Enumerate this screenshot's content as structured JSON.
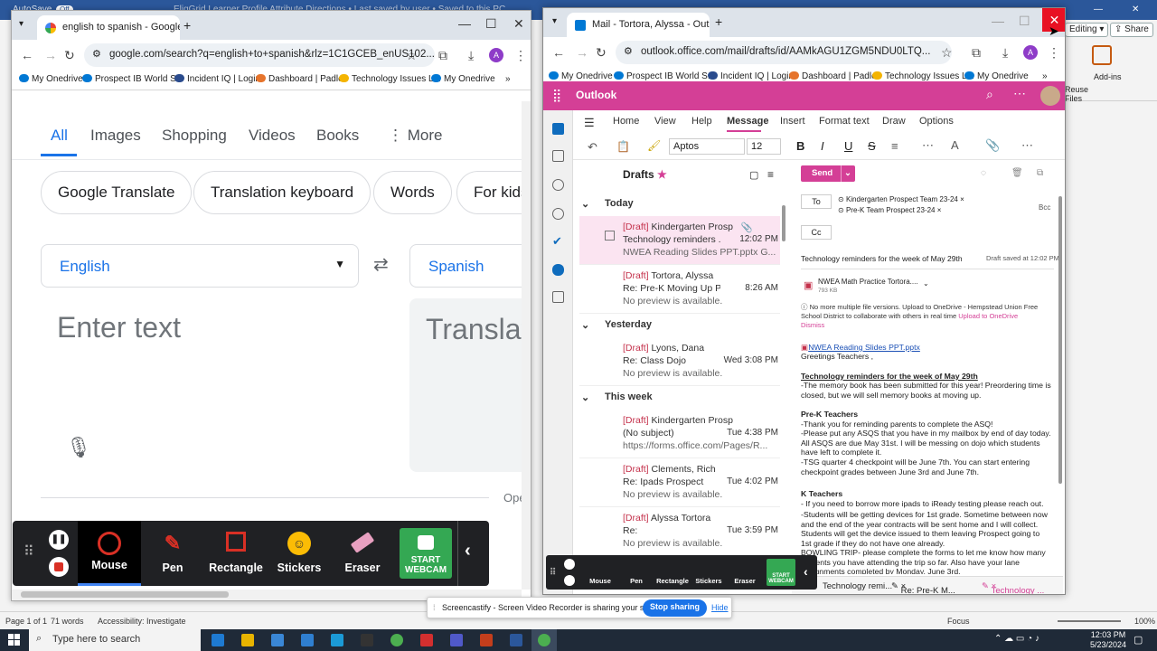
{
  "word": {
    "autosave": "AutoSave",
    "autosave_state": "Off",
    "title": "EligGrid Learner Profile Attribute Directions • Last saved by user • Saved to this PC",
    "search": "Search",
    "editing": "Editing",
    "share": "Share",
    "reuse_files": "Reuse Files",
    "add_ins": "Add-ins",
    "status_page": "Page 1 of 1",
    "status_words": "71 words",
    "status_accessibility": "Accessibility: Investigate",
    "status_focus": "Focus",
    "status_zoom": "100%"
  },
  "chrome_left": {
    "tab_title": "english to spanish - Google Sea",
    "url": "google.com/search?q=english+to+spanish&rlz=1C1GCEB_enUS102...",
    "bookmarks": [
      "My Onedrive",
      "Prospect IB World S...",
      "Incident IQ | Login",
      "Dashboard | Padlet",
      "Technology Issues L...",
      "My Onedrive"
    ],
    "search_tabs": [
      "All",
      "Images",
      "Shopping",
      "Videos",
      "Books",
      "More"
    ],
    "chips": [
      "Google Translate",
      "Translation keyboard",
      "Words",
      "For kids"
    ],
    "source_lang": "English",
    "target_lang": "Spanish",
    "enter_text": "Enter text",
    "translation": "Translation",
    "open_label": "Ope"
  },
  "screencastify": {
    "tools": [
      "Mouse",
      "Pen",
      "Rectangle",
      "Stickers",
      "Eraser"
    ],
    "webcam": "START WEBCAM",
    "share_text": "Screencastify - Screen Video Recorder is sharing your screen.",
    "stop_sharing": "Stop sharing",
    "hide": "Hide"
  },
  "outlook": {
    "tab_title": "Mail - Tortora, Alyssa - Outlook",
    "url": "outlook.office.com/mail/drafts/id/AAMkAGU1ZGM5NDU0LTQ...",
    "bookmarks": [
      "My Onedrive",
      "Prospect IB World S...",
      "Incident IQ | Login",
      "Dashboard | Padlet",
      "Technology Issues L...",
      "My Onedrive"
    ],
    "app_name": "Outlook",
    "menu": [
      "Home",
      "View",
      "Help",
      "Message",
      "Insert",
      "Format text",
      "Draw",
      "Options"
    ],
    "font": "Aptos",
    "font_size": "12",
    "folder": "Drafts",
    "groups": [
      "Today",
      "Yesterday",
      "This week"
    ],
    "mails": [
      {
        "tag": "[Draft]",
        "from": "Kindergarten Prospe...",
        "subject": "Technology reminders ...",
        "time": "12:02 PM",
        "preview": "NWEA Reading Slides PPT.pptx G..."
      },
      {
        "tag": "[Draft]",
        "from": "Tortora, Alyssa",
        "subject": "Re: Pre-K Moving Up Pr...",
        "time": "8:26 AM",
        "preview": "No preview is available."
      },
      {
        "tag": "[Draft]",
        "from": "Lyons, Dana",
        "subject": "Re: Class Dojo",
        "time": "Wed 3:08 PM",
        "preview": "No preview is available."
      },
      {
        "tag": "[Draft]",
        "from": "Kindergarten Prospect Tea...",
        "subject": "(No subject)",
        "time": "Tue 4:38 PM",
        "preview": "https://forms.office.com/Pages/R..."
      },
      {
        "tag": "[Draft]",
        "from": "Clements, Rich",
        "subject": "Re: Ipads Prospect",
        "time": "Tue 4:02 PM",
        "preview": "No preview is available."
      },
      {
        "tag": "[Draft]",
        "from": "Alyssa Tortora",
        "subject": "Re:",
        "time": "Tue 3:59 PM",
        "preview": "No preview is available."
      }
    ],
    "compose": {
      "send": "Send",
      "to_label": "To",
      "cc_label": "Cc",
      "bcc": "Bcc",
      "recipients": [
        "Kindergarten Prospect Team 23-24",
        "Pre-K Team Prospect 23-24"
      ],
      "subject": "Technology reminders for the week of May 29th",
      "saved": "Draft saved at 12:02 PM",
      "attachment_name": "NWEA Math Practice Tortora....",
      "attachment_size": "793 KB",
      "notice": "No more multiple file versions. Upload to OneDrive - Hempstead Union Free School District to collaborate with others in real time",
      "upload_link": "Upload to OneDrive",
      "dismiss": "Dismiss",
      "link": "NWEA Reading Slides PPT.pptx",
      "greeting": "Greetings Teachers ,",
      "heading": "Technology reminders for the week of May 29th",
      "p1": "-The memory book has been submitted for this year! Preordering time is closed, but we will sell memory books at moving up.",
      "prek_head": "Pre-K Teachers",
      "prek1": "-Thank you for reminding parents to complete the ASQ!",
      "prek2": "-Please put any ASQS that you have in my mailbox by end of day today. All ASQS are due May 31st. I will be messing on dojo which students have left to complete it.",
      "prek3": "-TSG quarter 4 checkpoint will be June 7th. You can start entering checkpoint grades between June 3rd and June 7th.",
      "k_head": "K Teachers",
      "k1": "- If you need to borrow more ipads to iReady testing please reach out.",
      "k2": "-Students will be getting devices for 1st grade. Sometime between now and the end of the year contracts will be sent home and I will collect. Students will get the device issued to them leaving Prospect going to 1st grade if they do not have one already.",
      "k3": "BOWLING TRIP- please complete the forms to let me know how many students you have attending the trip so far. Also have your lane assignments completed by Monday, June 3rd."
    },
    "bottom_tabs": [
      "Technology remi...",
      "Re: Pre-K M...",
      "Technology ..."
    ]
  },
  "taskbar": {
    "search_placeholder": "Type here to search",
    "time": "12:03 PM",
    "date": "5/23/2024"
  },
  "colors": {
    "outlook_pink": "#d43f96",
    "google_blue": "#1a73e8",
    "close_red": "#e81123",
    "webcam_green": "#34a853",
    "draft_red": "#c4314b"
  }
}
